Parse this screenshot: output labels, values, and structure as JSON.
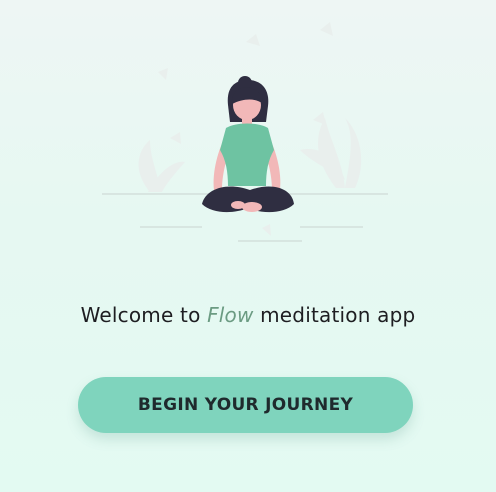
{
  "welcome": {
    "prefix": "Welcome to ",
    "brand": "Flow",
    "suffix": " meditation app"
  },
  "cta": {
    "label": "BEGIN YOUR JOURNEY"
  },
  "colors": {
    "accent": "#7fd4bd",
    "brand_text": "#6b9b82",
    "shirt": "#6ec3a2",
    "pants": "#2f2e41",
    "skin": "#f2b8b8"
  },
  "icons": {
    "hero": "meditation-illustration"
  }
}
